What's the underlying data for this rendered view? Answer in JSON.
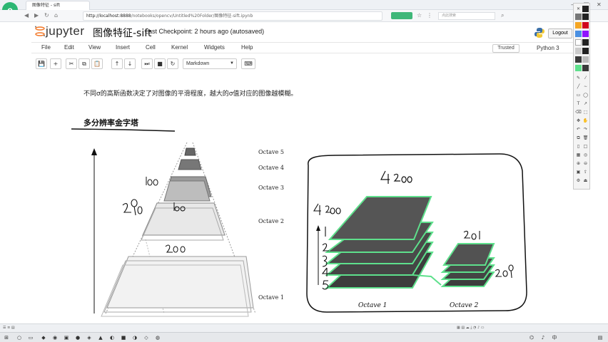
{
  "browser": {
    "tab_title": "图像特征 - sift",
    "address_host": "http://localhost:8888",
    "address_path": "/notebooks/opencv/Untitled%20Folder/图像特征-sift.ipynb",
    "search_placeholder": "点此搜索"
  },
  "jupyter": {
    "logo_text": "jupyter",
    "notebook_title": "图像特征-sift",
    "checkpoint": "Last Checkpoint: 2 hours ago (autosaved)",
    "logout_label": "Logout",
    "trusted_label": "Trusted",
    "kernel_label": "Python 3",
    "menu": [
      "File",
      "Edit",
      "View",
      "Insert",
      "Cell",
      "Kernel",
      "Widgets",
      "Help"
    ],
    "cell_type": "Markdown"
  },
  "content": {
    "paragraph": "不同σ的高斯函数决定了对图像的平滑程度，越大的σ值对应的图像越模糊。",
    "heading": "多分辨率金字塔",
    "octave_labels": [
      "Octave 5",
      "Octave 4",
      "Octave 3",
      "Octave 2",
      "Octave 1"
    ],
    "right_figure_labels": [
      "Octave 1",
      "Octave 2"
    ]
  },
  "colors": {
    "accent_green": "#3fb779",
    "slab_green": "#5ee08c"
  }
}
